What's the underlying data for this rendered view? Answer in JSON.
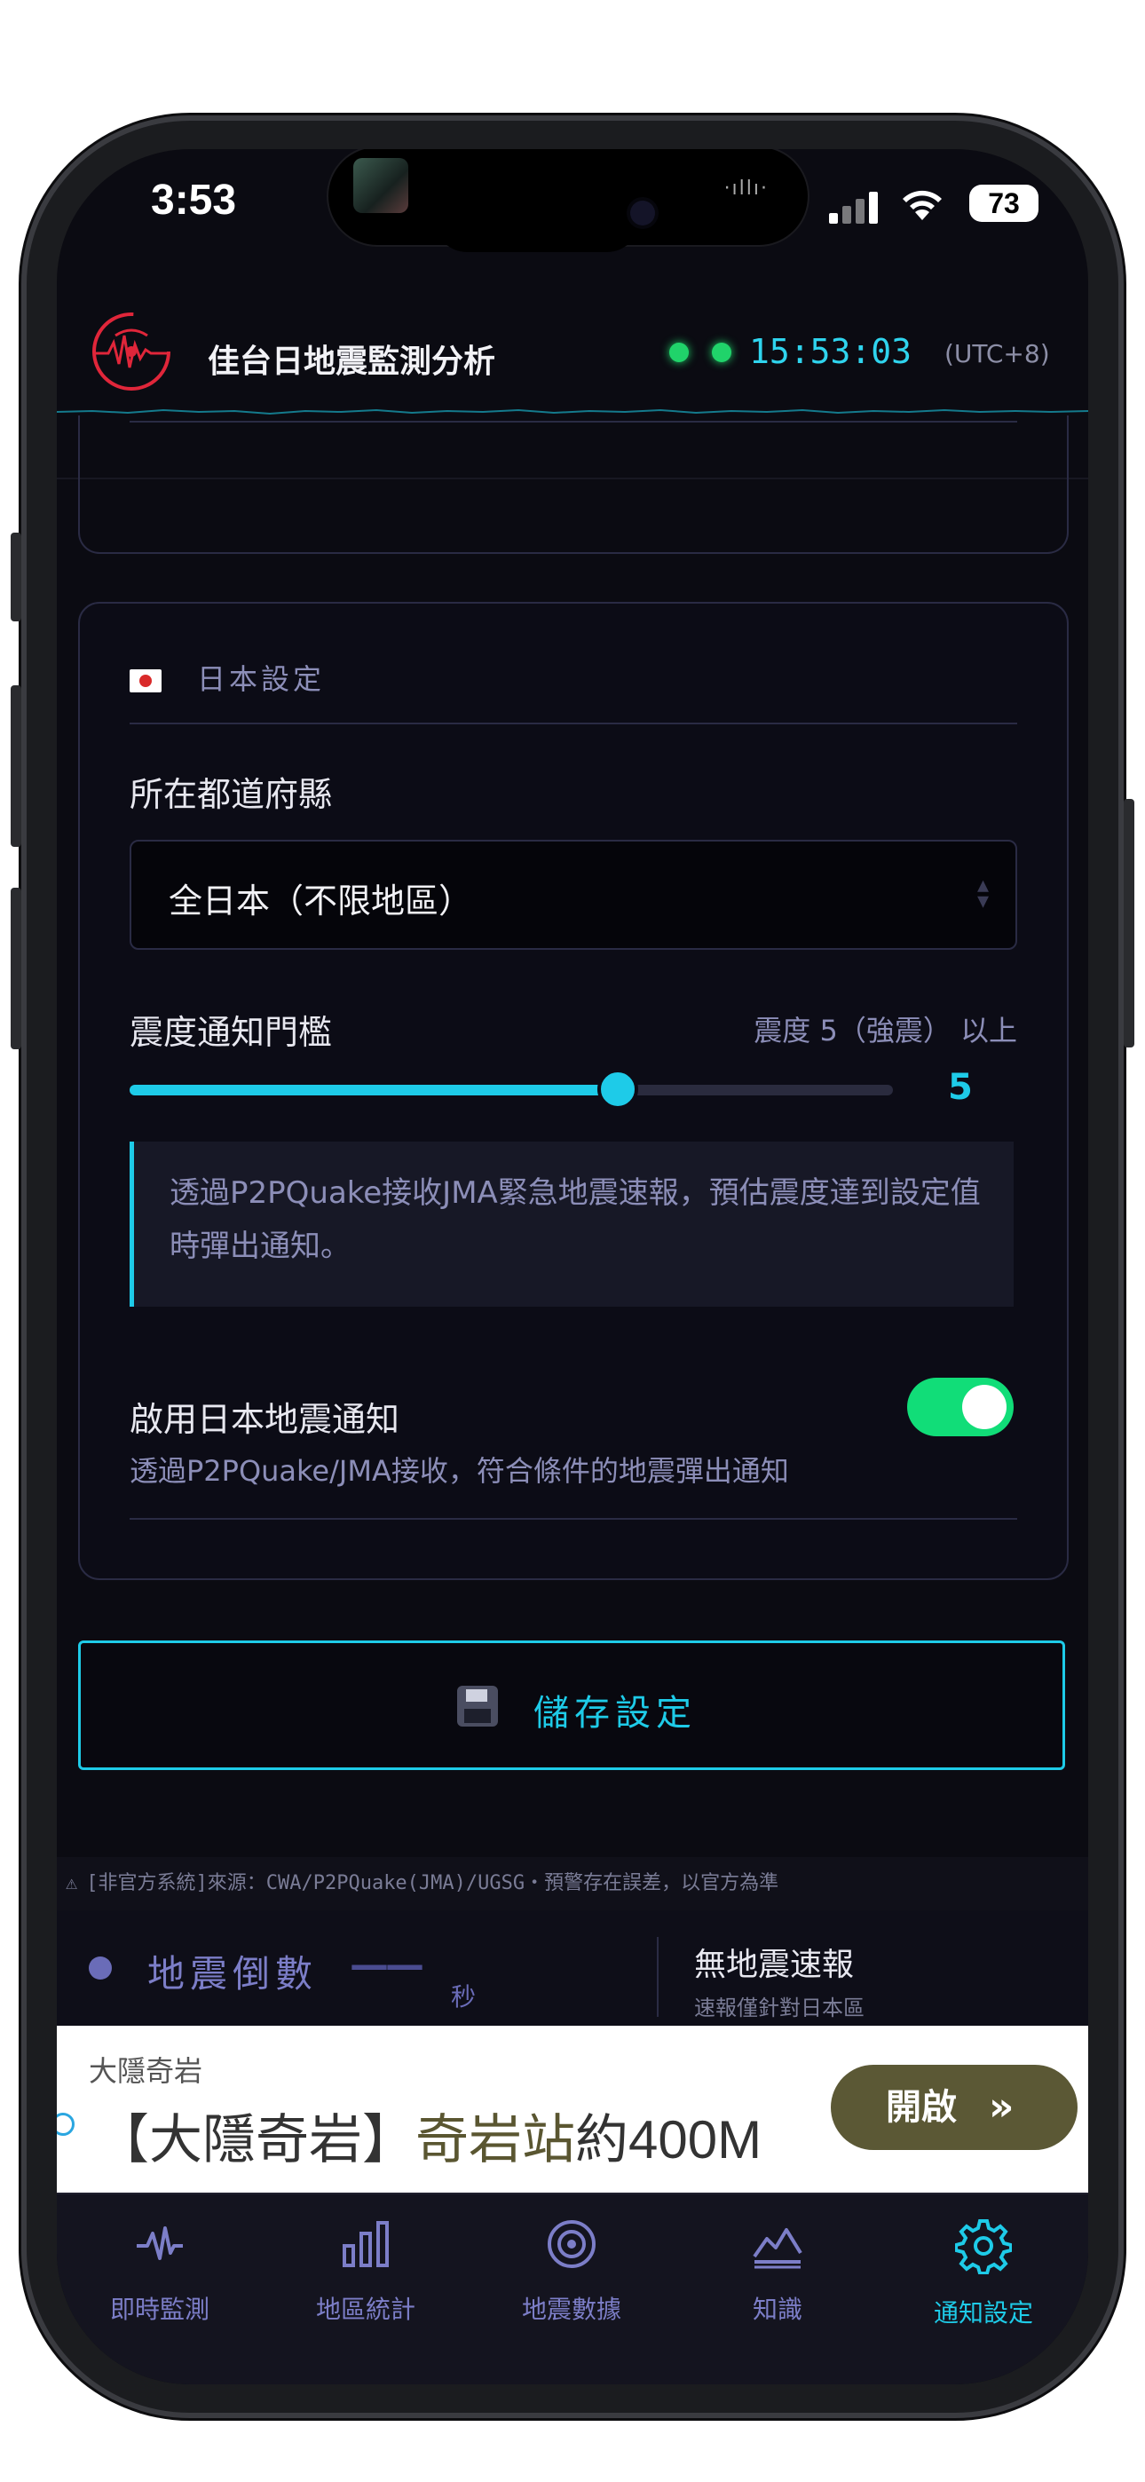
{
  "status_bar": {
    "time": "3:53",
    "battery": "73"
  },
  "header": {
    "app_title": "佳台日地震監測分析",
    "clock": "15:53:03",
    "timezone": "(UTC+8)"
  },
  "japan_settings": {
    "section_title": "日本設定",
    "prefecture_label": "所在都道府縣",
    "prefecture_value": "全日本（不限地區）",
    "threshold_label": "震度通知門檻",
    "threshold_desc": "震度 5（強震） 以上",
    "threshold_value": "5",
    "threshold_fraction": 0.64,
    "info_text": "透過P2PQuake接收JMA緊急地震速報，預估震度達到設定值時彈出通知。",
    "toggle_title": "啟用日本地震通知",
    "toggle_sub": "透過P2PQuake/JMA接收，符合條件的地震彈出通知",
    "toggle_on": true
  },
  "save_label": "儲存設定",
  "disclaimer": "[非官方系統]來源：CWA/P2PQuake(JMA)/UGSG・預警存在誤差，以官方為準",
  "countdown": {
    "label": "地震倒數",
    "value": "——",
    "unit": "秒",
    "status": "無地震速報",
    "status_sub": "速報僅針對日本區"
  },
  "ad": {
    "advertiser": "大隱奇岩",
    "headline_prefix": "【大隱奇岩】",
    "headline_highlight": "奇岩站",
    "headline_suffix": "約400M",
    "button": "開啟",
    "button_arrow": "»"
  },
  "nav": [
    {
      "label": "即時監測",
      "icon": "pulse-icon",
      "active": false
    },
    {
      "label": "地區統計",
      "icon": "bar-chart-icon",
      "active": false
    },
    {
      "label": "地震數據",
      "icon": "target-icon",
      "active": false
    },
    {
      "label": "知識",
      "icon": "area-chart-icon",
      "active": false
    },
    {
      "label": "通知設定",
      "icon": "gear-icon",
      "active": true
    }
  ],
  "colors": {
    "accent": "#1ecbe8",
    "toggle_on": "#11dd78",
    "status_green": "#20d36a",
    "bg": "#0b0b12"
  }
}
